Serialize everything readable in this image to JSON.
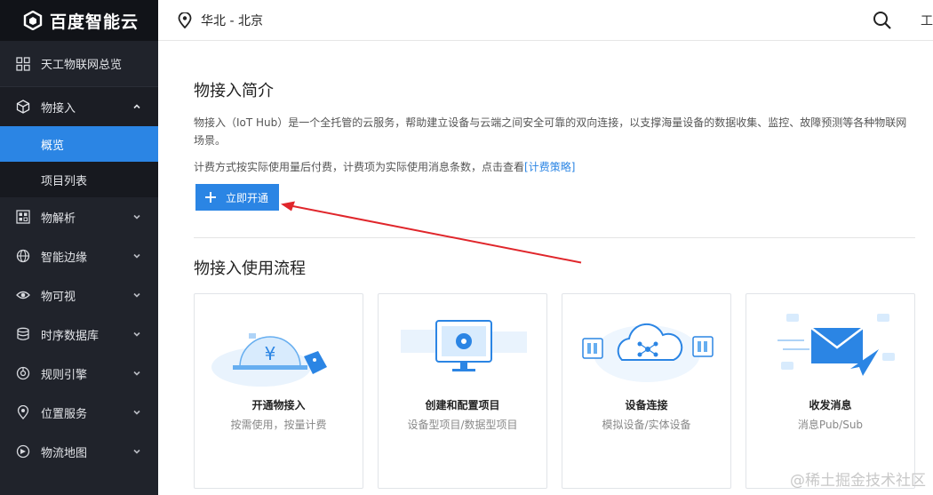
{
  "brand": {
    "name": "百度智能云"
  },
  "header": {
    "region": "华北 - 北京",
    "more_label": "工"
  },
  "sidebar": {
    "overview": "天工物联网总览",
    "items": [
      {
        "label": "物接入",
        "icon": "cube-icon",
        "expanded": true
      },
      {
        "label": "物解析",
        "icon": "qr-grid-icon"
      },
      {
        "label": "智能边缘",
        "icon": "globe-icon"
      },
      {
        "label": "物可视",
        "icon": "eye-icon"
      },
      {
        "label": "时序数据库",
        "icon": "database-icon"
      },
      {
        "label": "规则引擎",
        "icon": "engine-icon"
      },
      {
        "label": "位置服务",
        "icon": "location-icon"
      },
      {
        "label": "物流地图",
        "icon": "map-icon"
      }
    ],
    "sub_items": [
      {
        "label": "概览",
        "active": true
      },
      {
        "label": "项目列表",
        "active": false
      }
    ]
  },
  "main": {
    "intro_title": "物接入简介",
    "intro_text": "物接入（IoT Hub）是一个全托管的云服务，帮助建立设备与云端之间安全可靠的双向连接，以支撑海量设备的数据收集、监控、故障预测等各种物联网场景。",
    "billing_text": "计费方式按实际使用量后付费，计费项为实际使用消息条数，点击查看",
    "billing_link": "[计费策略]",
    "open_button": "立即开通",
    "flow_title": "物接入使用流程",
    "cards": [
      {
        "title": "开通物接入",
        "desc": "按需使用，按量计费"
      },
      {
        "title": "创建和配置项目",
        "desc": "设备型项目/数据型项目"
      },
      {
        "title": "设备连接",
        "desc": "模拟设备/实体设备"
      },
      {
        "title": "收发消息",
        "desc": "消息Pub/Sub"
      }
    ]
  },
  "watermark": "@稀土掘金技术社区",
  "colors": {
    "accent": "#2b85e4",
    "sidebar_bg": "#20232b",
    "arrow": "#e0262b"
  }
}
